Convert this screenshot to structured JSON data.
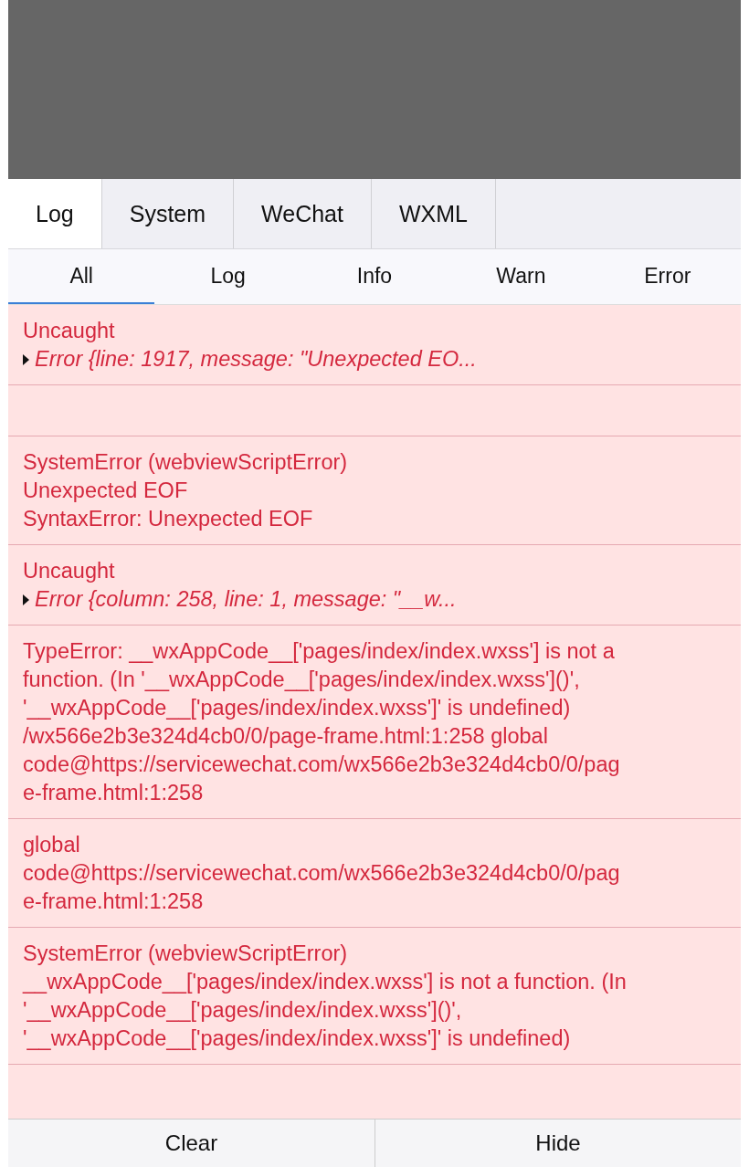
{
  "tabs": [
    {
      "label": "Log",
      "selected": true
    },
    {
      "label": "System",
      "selected": false
    },
    {
      "label": "WeChat",
      "selected": false
    },
    {
      "label": "WXML",
      "selected": false
    }
  ],
  "filters": [
    {
      "label": "All",
      "selected": true
    },
    {
      "label": "Log",
      "selected": false
    },
    {
      "label": "Info",
      "selected": false
    },
    {
      "label": "Warn",
      "selected": false
    },
    {
      "label": "Error",
      "selected": false
    }
  ],
  "entries": [
    {
      "kind": "message",
      "lines": [
        {
          "kind": "text",
          "text": "Uncaught"
        },
        {
          "kind": "object",
          "text": "Error {line: 1917, message: \"Unexpected EO..."
        }
      ]
    },
    {
      "kind": "blank"
    },
    {
      "kind": "message",
      "lines": [
        {
          "kind": "text",
          "text": "SystemError (webviewScriptError)\nUnexpected EOF\nSyntaxError: Unexpected EOF"
        }
      ]
    },
    {
      "kind": "message",
      "lines": [
        {
          "kind": "text",
          "text": "Uncaught"
        },
        {
          "kind": "object",
          "text": "Error {column: 258, line: 1, message: \"__w..."
        }
      ]
    },
    {
      "kind": "message",
      "lines": [
        {
          "kind": "text",
          "text": "TypeError: __wxAppCode__['pages/index/index.wxss'] is not a function. (In '__wxAppCode__['pages/index/index.wxss']()', '__wxAppCode__['pages/index/index.wxss']' is undefined) /wx566e2b3e324d4cb0/0/page-frame.html:1:258 global code@https://servicewechat.com/wx566e2b3e324d4cb0/0/page-frame.html:1:258"
        }
      ]
    },
    {
      "kind": "message",
      "lines": [
        {
          "kind": "text",
          "text": "global code@https://servicewechat.com/wx566e2b3e324d4cb0/0/page-frame.html:1:258"
        }
      ]
    },
    {
      "kind": "message",
      "lines": [
        {
          "kind": "text",
          "text": "SystemError (webviewScriptError)\n__wxAppCode__['pages/index/index.wxss'] is not a function. (In '__wxAppCode__['pages/index/index.wxss']()', '__wxAppCode__['pages/index/index.wxss']' is undefined)"
        }
      ]
    }
  ],
  "buttons": [
    {
      "label": "Clear"
    },
    {
      "label": "Hide"
    }
  ]
}
